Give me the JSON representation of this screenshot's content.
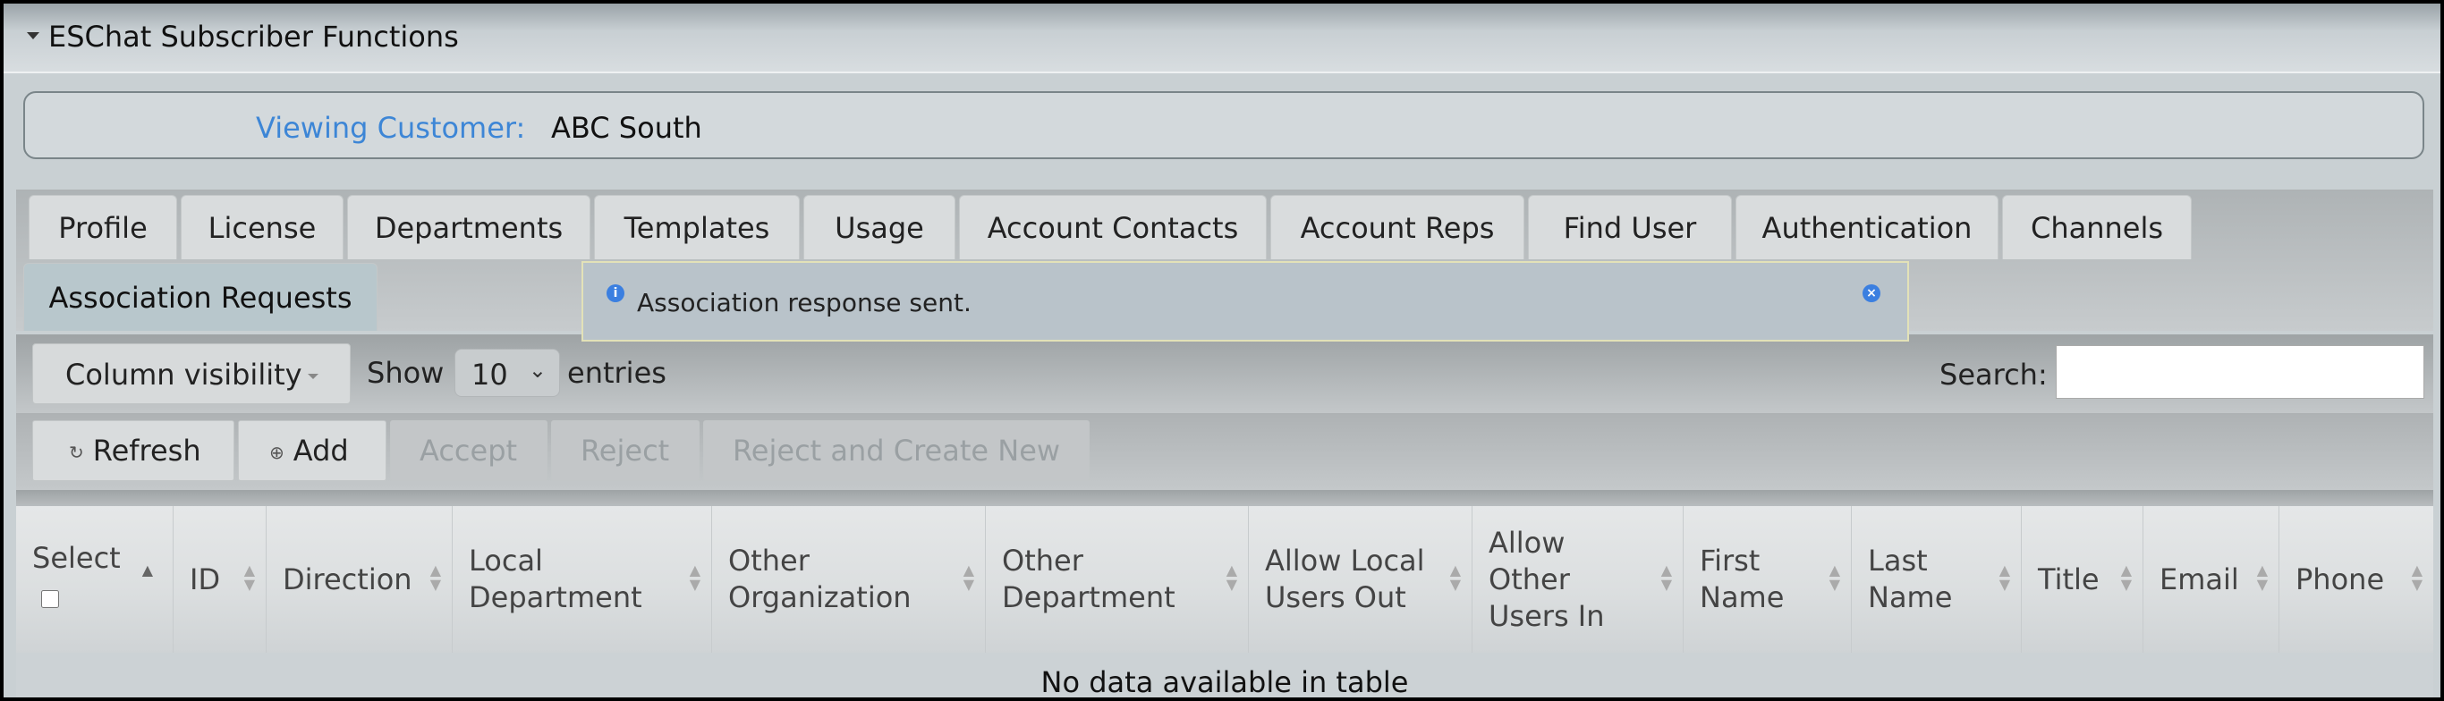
{
  "panel": {
    "title": "ESChat Subscriber Functions"
  },
  "customer": {
    "label": "Viewing Customer:",
    "value": "ABC South"
  },
  "tabs": [
    {
      "label": "Profile"
    },
    {
      "label": "License"
    },
    {
      "label": "Departments"
    },
    {
      "label": "Templates"
    },
    {
      "label": "Usage"
    },
    {
      "label": "Account Contacts"
    },
    {
      "label": "Account Reps"
    },
    {
      "label": "Find User"
    },
    {
      "label": "Authentication"
    },
    {
      "label": "Channels"
    },
    {
      "label": "Association Requests",
      "active": true
    }
  ],
  "alert": {
    "message": "Association response sent.",
    "icon": "info-icon",
    "close_icon": "close-icon"
  },
  "controls": {
    "column_visibility": "Column visibility",
    "show_label": "Show",
    "page_length": "10",
    "entries_label": "entries",
    "search_label": "Search:",
    "search_value": ""
  },
  "actions": {
    "refresh": "Refresh",
    "add": "Add",
    "accept": "Accept",
    "reject": "Reject",
    "reject_create": "Reject and Create New"
  },
  "table": {
    "columns": [
      "Select",
      "ID",
      "Direction",
      "Local\nDepartment",
      "Other\nOrganization",
      "Other\nDepartment",
      "Allow Local\nUsers Out",
      "Allow\nOther\nUsers In",
      "First\nName",
      "Last\nName",
      "Title",
      "Email",
      "Phone"
    ],
    "empty_message": "No data available in table"
  },
  "colors": {
    "accent": "#3d86d6",
    "alert_bg": "#b9c3ca",
    "panel_bg": "#c9d0d3"
  }
}
